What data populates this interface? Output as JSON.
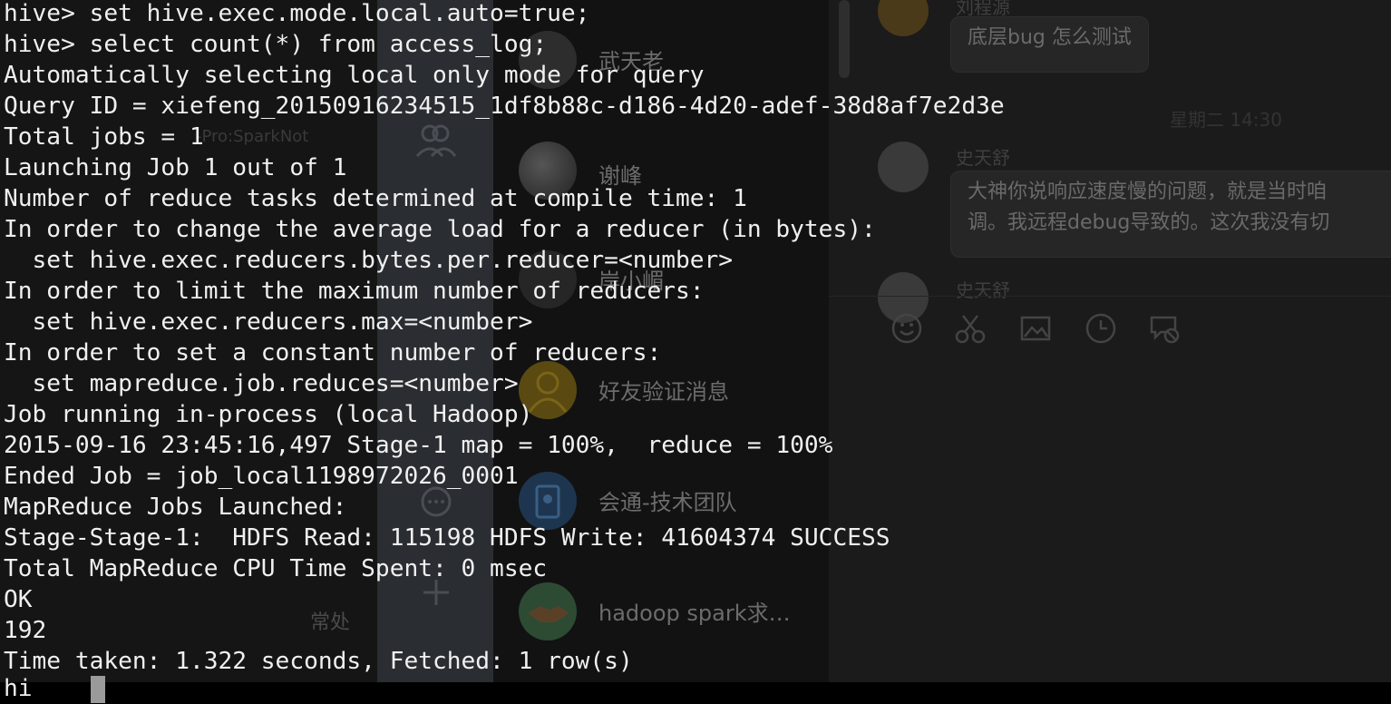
{
  "terminal": {
    "lines": [
      "hive> set hive.exec.mode.local.auto=true;",
      "hive> select count(*) from access_log;",
      "Automatically selecting local only mode for query",
      "Query ID = xiefeng_20150916234515_1df8b88c-d186-4d20-adef-38d8af7e2d3e",
      "Total jobs = 1",
      "Launching Job 1 out of 1",
      "Number of reduce tasks determined at compile time: 1",
      "In order to change the average load for a reducer (in bytes):",
      "  set hive.exec.reducers.bytes.per.reducer=<number>",
      "In order to limit the maximum number of reducers:",
      "  set hive.exec.reducers.max=<number>",
      "In order to set a constant number of reducers:",
      "  set mapreduce.job.reduces=<number>",
      "Job running in-process (local Hadoop)",
      "2015-09-16 23:45:16,497 Stage-1 map = 100%,  reduce = 100%",
      "Ended Job = job_local1198972026_0001",
      "MapReduce Jobs Launched:",
      "Stage-Stage-1:  HDFS Read: 115198 HDFS Write: 41604374 SUCCESS",
      "Total MapReduce CPU Time Spent: 0 msec",
      "OK",
      "192",
      "Time taken: 1.322 seconds, Fetched: 1 row(s)"
    ],
    "partial_prompt": "hi"
  },
  "background": {
    "left_ghost_text": [
      "-Pro:SparkNot",
      "常处"
    ],
    "contacts": [
      {
        "name": "武天老"
      },
      {
        "name": "谢峰"
      },
      {
        "name": "岸小嵋"
      },
      {
        "name": "好友验证消息"
      },
      {
        "name": "会通-技术团队"
      },
      {
        "name": "hadoop spark求…"
      }
    ],
    "chat": {
      "time_label": "星期二 14:30",
      "messages": [
        {
          "sender": "刘程源",
          "text": "底层bug 怎么测试"
        },
        {
          "sender": "史天舒",
          "text": "大神你说响应速度慢的问题，就是当时咱",
          "text2": "调。我远程debug导致的。这次我没有切"
        },
        {
          "sender": "史天舒"
        }
      ]
    }
  },
  "colors": {
    "terminal_text": "#f0f0f0",
    "terminal_bg": "#000000",
    "sidebar_bg": "#2a2d31",
    "chat_bg": "#1b1b1b"
  }
}
